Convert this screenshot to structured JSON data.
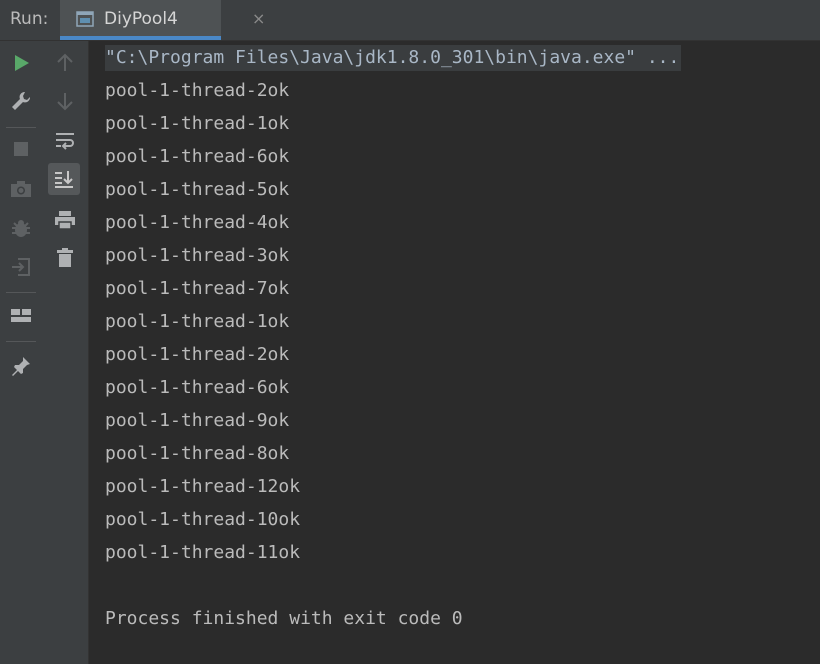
{
  "header": {
    "run_label": "Run:",
    "tab_title": "DiyPool4",
    "tab_close": "×"
  },
  "toolbar_left": [
    {
      "icon": "run-icon",
      "color": "#59a869"
    },
    {
      "icon": "wrench-icon"
    },
    {
      "icon": "stop-icon"
    },
    {
      "icon": "camera-icon"
    },
    {
      "icon": "bug-icon"
    },
    {
      "icon": "login-icon"
    },
    {
      "icon": "layout-icon"
    },
    {
      "icon": "pin-icon"
    }
  ],
  "toolbar_right": [
    {
      "icon": "arrow-up-icon"
    },
    {
      "icon": "arrow-down-icon"
    },
    {
      "icon": "soft-wrap-icon"
    },
    {
      "icon": "scroll-to-end-icon",
      "active": true
    },
    {
      "icon": "print-icon"
    },
    {
      "icon": "trash-icon"
    }
  ],
  "console": {
    "command": "\"C:\\Program Files\\Java\\jdk1.8.0_301\\bin\\java.exe\" ...",
    "lines": [
      "pool-1-thread-2ok",
      "pool-1-thread-1ok",
      "pool-1-thread-6ok",
      "pool-1-thread-5ok",
      "pool-1-thread-4ok",
      "pool-1-thread-3ok",
      "pool-1-thread-7ok",
      "pool-1-thread-1ok",
      "pool-1-thread-2ok",
      "pool-1-thread-6ok",
      "pool-1-thread-9ok",
      "pool-1-thread-8ok",
      "pool-1-thread-12ok",
      "pool-1-thread-10ok",
      "pool-1-thread-11ok"
    ],
    "exit_message": "Process finished with exit code 0"
  },
  "colors": {
    "background": "#2b2b2b",
    "toolbar": "#3c3f41",
    "text": "#bbbbbb",
    "accent": "#4a88c7",
    "run": "#59a869"
  }
}
